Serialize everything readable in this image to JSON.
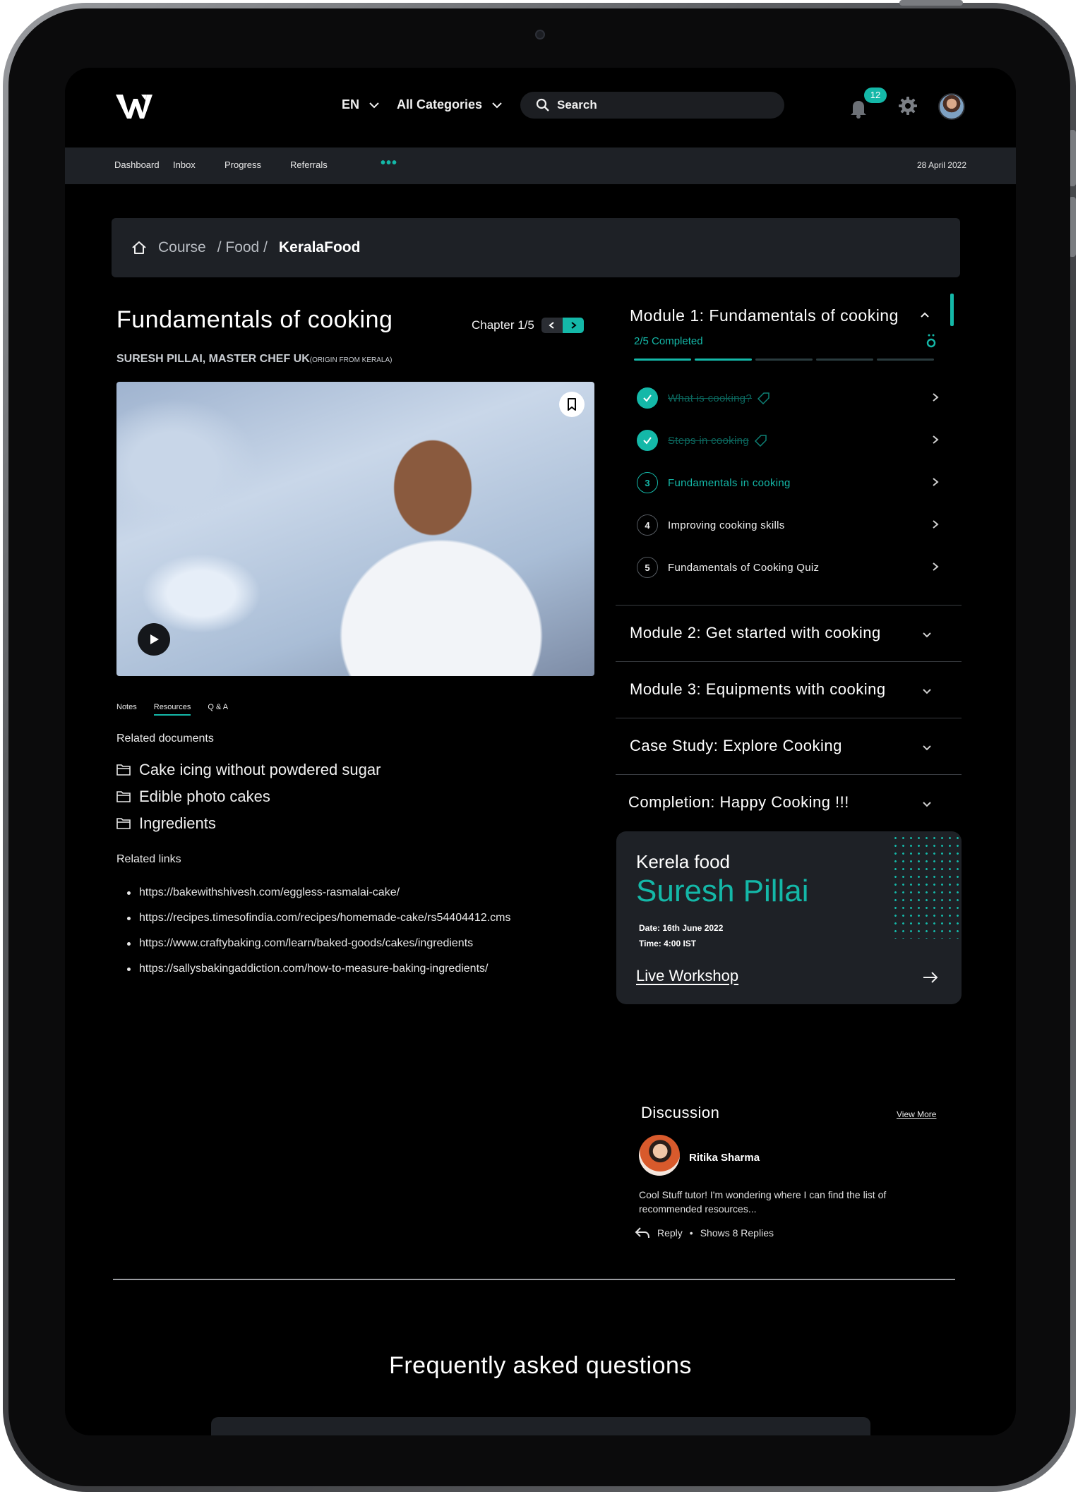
{
  "header": {
    "language": "EN",
    "category": "All Categories",
    "search_placeholder": "Search",
    "notification_count": "12"
  },
  "subnav": {
    "items": [
      "Dashboard",
      "Inbox",
      "Progress",
      "Referrals"
    ],
    "date": "28 April 2022"
  },
  "breadcrumb": {
    "course": "Course",
    "food": "/ Food /",
    "current": "KeralaFood"
  },
  "course": {
    "title": "Fundamentals of cooking",
    "chapter": "Chapter 1/5",
    "author": "SURESH PILLAI, MASTER CHEF UK",
    "author_origin": "(ORIGIN FROM KERALA)"
  },
  "tabs": [
    "Notes",
    "Resources",
    "Q & A"
  ],
  "resources": {
    "docs_label": "Related documents",
    "documents": [
      "Cake icing without powdered sugar",
      "Edible photo cakes",
      "Ingredients"
    ],
    "links_label": "Related links",
    "links": [
      "https://bakewithshivesh.com/eggless-rasmalai-cake/",
      "https://recipes.timesofindia.com/recipes/homemade-cake/rs54404412.cms",
      "https://www.craftybaking.com/learn/baked-goods/cakes/ingredients",
      "https://sallysbakingaddiction.com/how-to-measure-baking-ingredients/"
    ]
  },
  "module1": {
    "title": "Module 1: Fundamentals of cooking",
    "completed": "2/5 Completed",
    "completed_fraction": 0.4,
    "lessons": [
      {
        "num": "1",
        "label": "What is cooking?"
      },
      {
        "num": "2",
        "label": "Steps in cooking"
      },
      {
        "num": "3",
        "label": "Fundamentals in cooking"
      },
      {
        "num": "4",
        "label": "Improving  cooking skills"
      },
      {
        "num": "5",
        "label": "Fundamentals of Cooking Quiz"
      }
    ]
  },
  "modules": [
    "Module 2: Get started with cooking",
    "Module 3: Equipments with cooking",
    "Case Study:  Explore Cooking",
    "Completion:  Happy Cooking !!!"
  ],
  "workshop": {
    "subtitle": "Kerela food",
    "name": "Suresh Pillai",
    "date": "Date: 16th June 2022",
    "time": "Time:  4:00 IST",
    "link": "Live Workshop"
  },
  "discussion": {
    "title": "Discussion",
    "view_more": "View More",
    "user": "Ritika Sharma",
    "text": "Cool Stuff tutor! I'm wondering where I can find the list of recommended resources...",
    "reply": "Reply",
    "replies": "Shows 8 Replies"
  },
  "faq": {
    "title": "Frequently asked questions"
  },
  "colors": {
    "accent": "#14b8a8",
    "background": "#000000",
    "panel": "#1e2126"
  }
}
